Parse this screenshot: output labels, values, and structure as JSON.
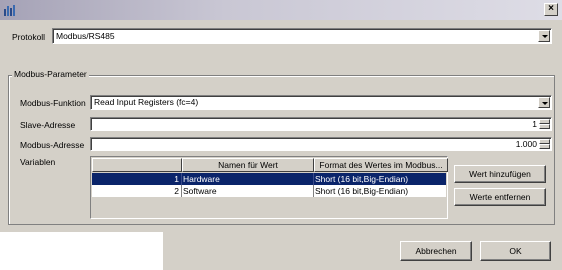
{
  "window": {
    "close_glyph": "×",
    "icon": "app-icon"
  },
  "protokoll": {
    "label": "Protokoll",
    "value": "Modbus/RS485"
  },
  "modbus": {
    "group_title": "Modbus-Parameter",
    "funktion_label": "Modbus-Funktion",
    "funktion_value": "Read Input Registers (fc=4)",
    "slave_label": "Slave-Adresse",
    "slave_value": "1",
    "adresse_label": "Modbus-Adresse",
    "adresse_value": "1.000",
    "variablen_label": "Variablen"
  },
  "table": {
    "columns": [
      "",
      "Namen für Wert",
      "Format des Wertes im Modbus..."
    ],
    "rows": [
      {
        "index": "1",
        "name": "Hardware",
        "format": "Short (16 bit,Big-Endian)",
        "selected": true
      },
      {
        "index": "2",
        "name": "Software",
        "format": "Short (16 bit,Big-Endian)",
        "selected": false
      }
    ]
  },
  "buttons": {
    "add": "Wert hinzufügen",
    "remove": "Werte entfernen",
    "cancel": "Abbrechen",
    "ok": "OK"
  },
  "colors": {
    "selection": "#0a246a",
    "dialog_bg": "#d4d0c8"
  }
}
